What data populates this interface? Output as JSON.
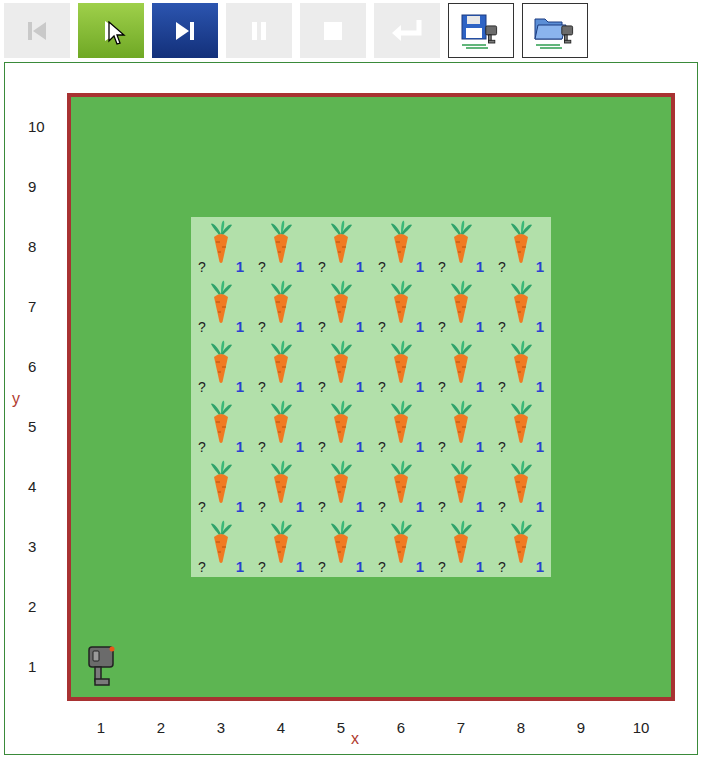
{
  "toolbar": {
    "buttons": [
      {
        "kind": "first",
        "disabled": true,
        "hovered": false
      },
      {
        "kind": "play",
        "disabled": false,
        "hovered": true
      },
      {
        "kind": "step",
        "disabled": false,
        "hovered": false
      },
      {
        "kind": "pause",
        "disabled": true,
        "hovered": false
      },
      {
        "kind": "stop",
        "disabled": true,
        "hovered": false
      },
      {
        "kind": "return",
        "disabled": true,
        "hovered": false
      },
      {
        "kind": "save",
        "disabled": false,
        "hovered": false
      },
      {
        "kind": "open",
        "disabled": false,
        "hovered": false
      }
    ]
  },
  "board": {
    "x_axis": {
      "label": "x",
      "ticks": [
        "1",
        "2",
        "3",
        "4",
        "5",
        "6",
        "7",
        "8",
        "9",
        "10"
      ]
    },
    "y_axis": {
      "label": "y",
      "ticks": [
        "10",
        "9",
        "8",
        "7",
        "6",
        "5",
        "4",
        "3",
        "2",
        "1"
      ]
    },
    "cells": [
      {
        "col": 3,
        "row": 8,
        "mark": "?",
        "count": "1"
      },
      {
        "col": 4,
        "row": 8,
        "mark": "?",
        "count": "1"
      },
      {
        "col": 5,
        "row": 8,
        "mark": "?",
        "count": "1"
      },
      {
        "col": 6,
        "row": 8,
        "mark": "?",
        "count": "1"
      },
      {
        "col": 7,
        "row": 8,
        "mark": "?",
        "count": "1"
      },
      {
        "col": 8,
        "row": 8,
        "mark": "?",
        "count": "1"
      },
      {
        "col": 3,
        "row": 7,
        "mark": "?",
        "count": "1"
      },
      {
        "col": 4,
        "row": 7,
        "mark": "?",
        "count": "1"
      },
      {
        "col": 5,
        "row": 7,
        "mark": "?",
        "count": "1"
      },
      {
        "col": 6,
        "row": 7,
        "mark": "?",
        "count": "1"
      },
      {
        "col": 7,
        "row": 7,
        "mark": "?",
        "count": "1"
      },
      {
        "col": 8,
        "row": 7,
        "mark": "?",
        "count": "1"
      },
      {
        "col": 3,
        "row": 6,
        "mark": "?",
        "count": "1"
      },
      {
        "col": 4,
        "row": 6,
        "mark": "?",
        "count": "1"
      },
      {
        "col": 5,
        "row": 6,
        "mark": "?",
        "count": "1"
      },
      {
        "col": 6,
        "row": 6,
        "mark": "?",
        "count": "1"
      },
      {
        "col": 7,
        "row": 6,
        "mark": "?",
        "count": "1"
      },
      {
        "col": 8,
        "row": 6,
        "mark": "?",
        "count": "1"
      },
      {
        "col": 3,
        "row": 5,
        "mark": "?",
        "count": "1"
      },
      {
        "col": 4,
        "row": 5,
        "mark": "?",
        "count": "1"
      },
      {
        "col": 5,
        "row": 5,
        "mark": "?",
        "count": "1"
      },
      {
        "col": 6,
        "row": 5,
        "mark": "?",
        "count": "1"
      },
      {
        "col": 7,
        "row": 5,
        "mark": "?",
        "count": "1"
      },
      {
        "col": 8,
        "row": 5,
        "mark": "?",
        "count": "1"
      },
      {
        "col": 3,
        "row": 4,
        "mark": "?",
        "count": "1"
      },
      {
        "col": 4,
        "row": 4,
        "mark": "?",
        "count": "1"
      },
      {
        "col": 5,
        "row": 4,
        "mark": "?",
        "count": "1"
      },
      {
        "col": 6,
        "row": 4,
        "mark": "?",
        "count": "1"
      },
      {
        "col": 7,
        "row": 4,
        "mark": "?",
        "count": "1"
      },
      {
        "col": 8,
        "row": 4,
        "mark": "?",
        "count": "1"
      },
      {
        "col": 3,
        "row": 3,
        "mark": "?",
        "count": "1"
      },
      {
        "col": 4,
        "row": 3,
        "mark": "?",
        "count": "1"
      },
      {
        "col": 5,
        "row": 3,
        "mark": "?",
        "count": "1"
      },
      {
        "col": 6,
        "row": 3,
        "mark": "?",
        "count": "1"
      },
      {
        "col": 7,
        "row": 3,
        "mark": "?",
        "count": "1"
      },
      {
        "col": 8,
        "row": 3,
        "mark": "?",
        "count": "1"
      }
    ],
    "robot": {
      "col": 1,
      "row": 1,
      "facing": "east"
    }
  }
}
